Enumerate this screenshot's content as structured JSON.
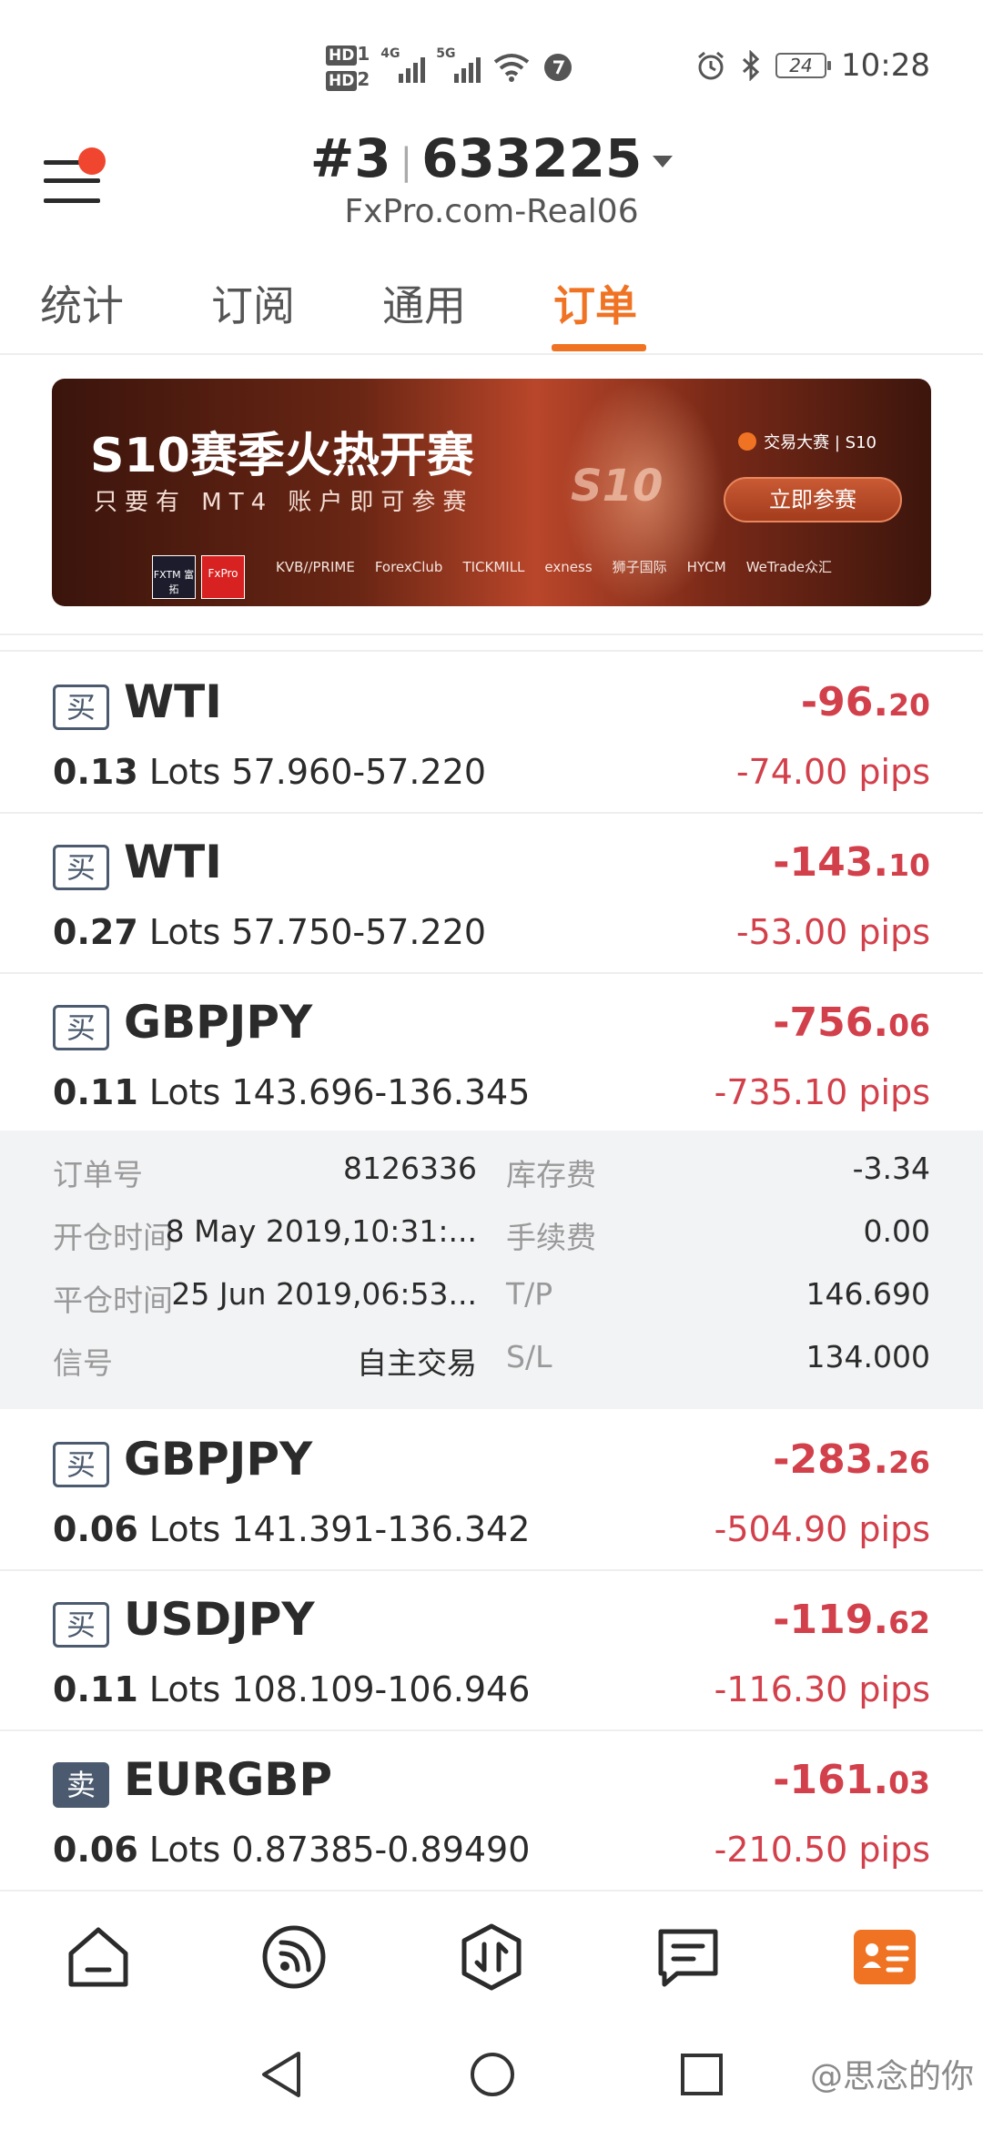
{
  "status_bar": {
    "hd1": "HD",
    "hd1_num": "1",
    "hd2": "HD",
    "hd2_num": "2",
    "net1": "4G",
    "net2": "5G",
    "battery": "24",
    "time": "10:28"
  },
  "header": {
    "account_prefix": "#3",
    "account_number": "633225",
    "server": "FxPro.com-Real06"
  },
  "tabs": [
    {
      "label": "统计"
    },
    {
      "label": "订阅"
    },
    {
      "label": "通用"
    },
    {
      "label": "订单",
      "active": true
    }
  ],
  "banner": {
    "title": "S10赛季火热开赛",
    "subtitle": "只要有 MT4 账户即可参赛",
    "brand": "交易大赛 | S10",
    "center_text": "S10",
    "cta": "立即参赛",
    "sponsors": [
      "KVB//PRIME",
      "ForexClub",
      "TICKMILL",
      "exness",
      "狮子国际",
      "HYCM",
      "WeTrade众汇"
    ],
    "logo_fxtm": "FXTM 富拓",
    "logo_fxpro": "FxPro"
  },
  "orders": [
    {
      "side": "买",
      "symbol": "WTI",
      "lots": "0.13",
      "lots_unit": "Lots",
      "prices": "57.960-57.220",
      "profit_main": "-96.",
      "profit_dec": "20",
      "pips": "-74.00 pips"
    },
    {
      "side": "买",
      "symbol": "WTI",
      "lots": "0.27",
      "lots_unit": "Lots",
      "prices": "57.750-57.220",
      "profit_main": "-143.",
      "profit_dec": "10",
      "pips": "-53.00 pips"
    },
    {
      "side": "买",
      "symbol": "GBPJPY",
      "lots": "0.11",
      "lots_unit": "Lots",
      "prices": "143.696-136.345",
      "profit_main": "-756.",
      "profit_dec": "06",
      "pips": "-735.10 pips"
    },
    {
      "side": "买",
      "symbol": "GBPJPY",
      "lots": "0.06",
      "lots_unit": "Lots",
      "prices": "141.391-136.342",
      "profit_main": "-283.",
      "profit_dec": "26",
      "pips": "-504.90 pips"
    },
    {
      "side": "买",
      "symbol": "USDJPY",
      "lots": "0.11",
      "lots_unit": "Lots",
      "prices": "108.109-106.946",
      "profit_main": "-119.",
      "profit_dec": "62",
      "pips": "-116.30 pips"
    },
    {
      "side": "卖",
      "symbol": "EURGBP",
      "lots": "0.06",
      "lots_unit": "Lots",
      "prices": "0.87385-0.89490",
      "profit_main": "-161.",
      "profit_dec": "03",
      "pips": "-210.50 pips"
    }
  ],
  "details": {
    "order_no_label": "订单号",
    "order_no": "8126336",
    "swap_label": "库存费",
    "swap": "-3.34",
    "open_time_label": "开仓时间",
    "open_time": "8 May 2019,10:31:...",
    "commission_label": "手续费",
    "commission": "0.00",
    "close_time_label": "平仓时间",
    "close_time": "25 Jun 2019,06:53...",
    "tp_label": "T/P",
    "tp": "146.690",
    "signal_label": "信号",
    "signal": "自主交易",
    "sl_label": "S/L",
    "sl": "134.000"
  },
  "bottom_nav": [
    "home-icon",
    "feed-icon",
    "trade-icon",
    "message-icon",
    "profile-card-icon"
  ],
  "accent_color": "#f07324",
  "loss_color": "#d2404b",
  "watermark": "@思念的你"
}
